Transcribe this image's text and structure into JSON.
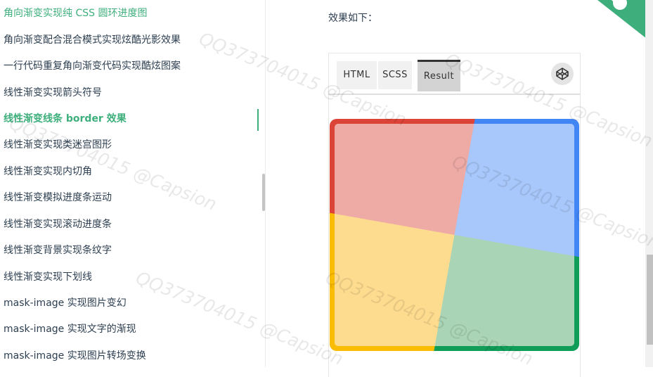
{
  "sidebar": {
    "items": [
      {
        "label": "角向渐变实现纯 CSS 圆环进度图",
        "top": true
      },
      {
        "label": "角向渐变配合混合模式实现炫酷光影效果"
      },
      {
        "label": "一行代码重复角向渐变代码实现酷炫图案"
      },
      {
        "label": "线性渐变实现箭头符号"
      },
      {
        "label": "线性渐变线条 border 效果",
        "active": true
      },
      {
        "label": "线性渐变实现类迷宫图形"
      },
      {
        "label": "线性渐变实现内切角"
      },
      {
        "label": "线性渐变模拟进度条运动"
      },
      {
        "label": "线性渐变实现滚动进度条"
      },
      {
        "label": "线性渐变背景实现条纹字"
      },
      {
        "label": "线性渐变实现下划线"
      },
      {
        "label": "mask-image 实现图片变幻"
      },
      {
        "label": "mask-image 实现文字的渐现"
      },
      {
        "label": "mask-image 实现图片转场变换"
      }
    ]
  },
  "main": {
    "intro": "效果如下：",
    "tabs": [
      {
        "label": "HTML"
      },
      {
        "label": "SCSS"
      },
      {
        "label": "Result"
      }
    ]
  },
  "watermark": "QQ373704015 @Capsion",
  "colors": {
    "accent": "#3eaf7c",
    "blue": "#4285f4",
    "green": "#0f9d58",
    "yellow": "#fbbc05",
    "red": "#db4437"
  }
}
